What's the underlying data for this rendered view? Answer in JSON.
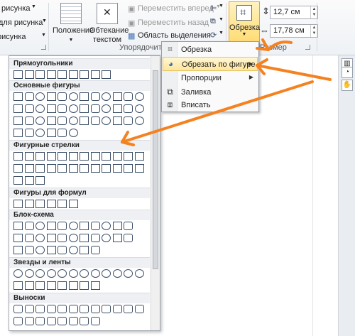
{
  "ribbon": {
    "left_items": [
      "рисунка",
      "для рисунка",
      "рисунка"
    ],
    "position_label": "Положение",
    "wrap_label_1": "Обтекание",
    "wrap_label_2": "текстом",
    "bring_forward": "Переместить вперед",
    "send_backward": "Переместить назад",
    "selection_pane": "Область выделения",
    "arrange_group": "Упорядочить",
    "size_group": "Размер",
    "crop_label": "Обрезка",
    "height_value": "12,7 см",
    "width_value": "17,78 см"
  },
  "crop_menu": {
    "items": [
      {
        "label": "Обрезка",
        "icon": "crop-icon"
      },
      {
        "label": "Обрезать по фигуре",
        "icon": "shape-crop-icon",
        "highlighted": true
      },
      {
        "label": "Пропорции",
        "icon": ""
      },
      {
        "label": "Заливка",
        "icon": "fill-icon"
      },
      {
        "label": "Вписать",
        "icon": "fit-icon"
      }
    ]
  },
  "shapes": {
    "sections": [
      {
        "title": "Прямоугольники"
      },
      {
        "title": "Основные фигуры"
      },
      {
        "title": "Фигурные стрелки"
      },
      {
        "title": "Фигуры для формул"
      },
      {
        "title": "Блок-схема"
      },
      {
        "title": "Звезды и ленты"
      },
      {
        "title": "Выноски"
      }
    ]
  },
  "colors": {
    "accent_orange": "#f58220",
    "highlight_fill": "#ffe69b",
    "shape_stroke": "#3a4d66"
  }
}
